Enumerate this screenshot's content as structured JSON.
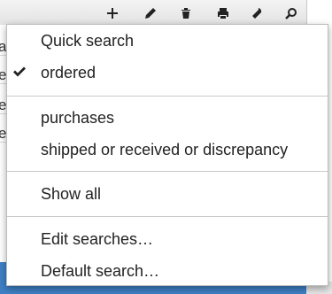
{
  "toolbar": {
    "icons": [
      "plus-icon",
      "pencil-icon",
      "trash-icon",
      "print-icon",
      "wrench-icon",
      "search-icon"
    ]
  },
  "background": {
    "left_fragments": [
      "a",
      "e",
      "e",
      "e"
    ]
  },
  "menu": {
    "groups": [
      {
        "items": [
          {
            "label": "Quick search",
            "checked": false
          },
          {
            "label": "ordered",
            "checked": true
          }
        ]
      },
      {
        "items": [
          {
            "label": "purchases",
            "checked": false
          },
          {
            "label": "shipped or received or discrepancy",
            "checked": false
          }
        ]
      },
      {
        "items": [
          {
            "label": "Show all",
            "checked": false
          }
        ]
      },
      {
        "items": [
          {
            "label": "Edit searches…",
            "checked": false
          },
          {
            "label": "Default search…",
            "checked": false
          }
        ]
      }
    ]
  },
  "colors": {
    "accent": "#3f80c4",
    "check": "#222222"
  }
}
